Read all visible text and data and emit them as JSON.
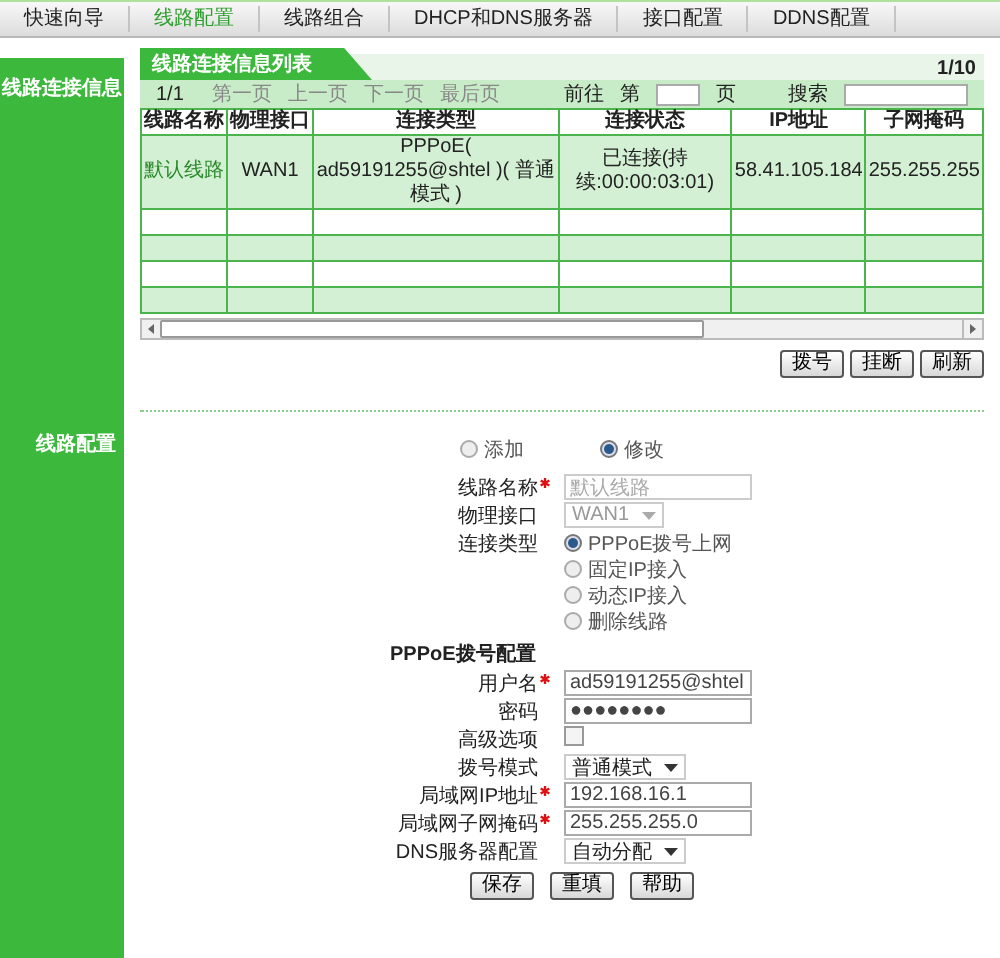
{
  "menu": [
    {
      "label": "快速向导",
      "selected": false
    },
    {
      "label": "线路配置",
      "selected": true
    },
    {
      "label": "线路组合",
      "selected": false
    },
    {
      "label": "DHCP和DNS服务器",
      "selected": false
    },
    {
      "label": "接口配置",
      "selected": false
    },
    {
      "label": "DDNS配置",
      "selected": false
    }
  ],
  "sidebar": {
    "info_label": "线路连接信息",
    "config_label": "线路配置"
  },
  "panel": {
    "title": "线路连接信息列表",
    "page_count": "1/10",
    "pager": {
      "page": "1/1",
      "links": [
        "第一页",
        "上一页",
        "下一页",
        "最后页"
      ],
      "goto_label": "前往",
      "page_prefix": "第",
      "page_suffix": "页",
      "search_label": "搜索"
    }
  },
  "table": {
    "columns": [
      "线路名称",
      "物理接口",
      "连接类型",
      "连接状态",
      "IP地址",
      "子网掩码"
    ],
    "rows": [
      {
        "cells": [
          "默认线路",
          "WAN1",
          "PPPoE( ad59191255@shtel )( 普通模式 )",
          "已连接(持续:00:00:03:01)",
          "58.41.105.184",
          "255.255.255"
        ]
      },
      {
        "cells": []
      },
      {
        "cells": []
      },
      {
        "cells": []
      },
      {
        "cells": []
      }
    ]
  },
  "table_buttons": [
    "拨号",
    "挂断",
    "刷新"
  ],
  "config": {
    "modes": [
      {
        "label": "添加",
        "selected": false
      },
      {
        "label": "修改",
        "selected": true
      }
    ],
    "fields": [
      {
        "kind": "text",
        "label": "线路名称",
        "required": true,
        "disabled": true,
        "value": "默认线路"
      },
      {
        "kind": "select",
        "label": "物理接口",
        "disabled": true,
        "value": "WAN1"
      },
      {
        "kind": "radios",
        "label": "连接类型",
        "options": [
          {
            "label": "PPPoE拨号上网",
            "selected": true
          },
          {
            "label": "固定IP接入",
            "selected": false
          },
          {
            "label": "动态IP接入",
            "selected": false
          },
          {
            "label": "删除线路",
            "selected": false
          }
        ]
      },
      {
        "kind": "heading",
        "label": "PPPoE拨号配置"
      },
      {
        "kind": "text",
        "label": "用户名",
        "required": true,
        "disabled": false,
        "value": "ad59191255@shtel"
      },
      {
        "kind": "password",
        "label": "密码",
        "value": "●●●●●●●●"
      },
      {
        "kind": "checkbox",
        "label": "高级选项",
        "checked": false
      },
      {
        "kind": "select",
        "label": "拨号模式",
        "disabled": false,
        "value": "普通模式"
      },
      {
        "kind": "text",
        "label": "局域网IP地址",
        "required": true,
        "disabled": false,
        "value": "192.168.16.1"
      },
      {
        "kind": "text",
        "label": "局域网子网掩码",
        "required": true,
        "disabled": false,
        "value": "255.255.255.0"
      },
      {
        "kind": "select",
        "label": "DNS服务器配置",
        "disabled": false,
        "value": "自动分配"
      }
    ],
    "buttons": [
      "保存",
      "重填",
      "帮助"
    ]
  }
}
